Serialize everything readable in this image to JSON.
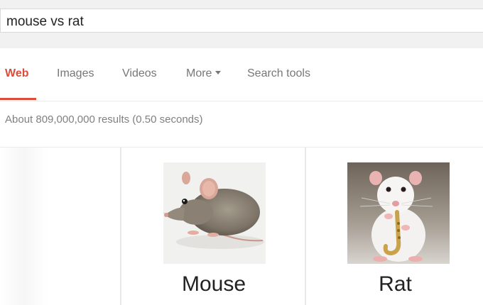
{
  "search": {
    "query": "mouse vs rat"
  },
  "tabs": [
    {
      "label": "Web",
      "active": true
    },
    {
      "label": "Images",
      "active": false
    },
    {
      "label": "Videos",
      "active": false
    },
    {
      "label": "More",
      "active": false
    },
    {
      "label": "Search tools",
      "active": false
    }
  ],
  "stats": {
    "text": "About 809,000,000 results (0.50 seconds)"
  },
  "comparison": {
    "items": [
      {
        "label": "Mouse",
        "image": "mouse-photo"
      },
      {
        "label": "Rat",
        "image": "rat-with-saxophone-photo"
      }
    ]
  },
  "colors": {
    "accent": "#dd4b39",
    "tab_text": "#777777",
    "stats_text": "#808080",
    "band": "#f1f1f1"
  }
}
